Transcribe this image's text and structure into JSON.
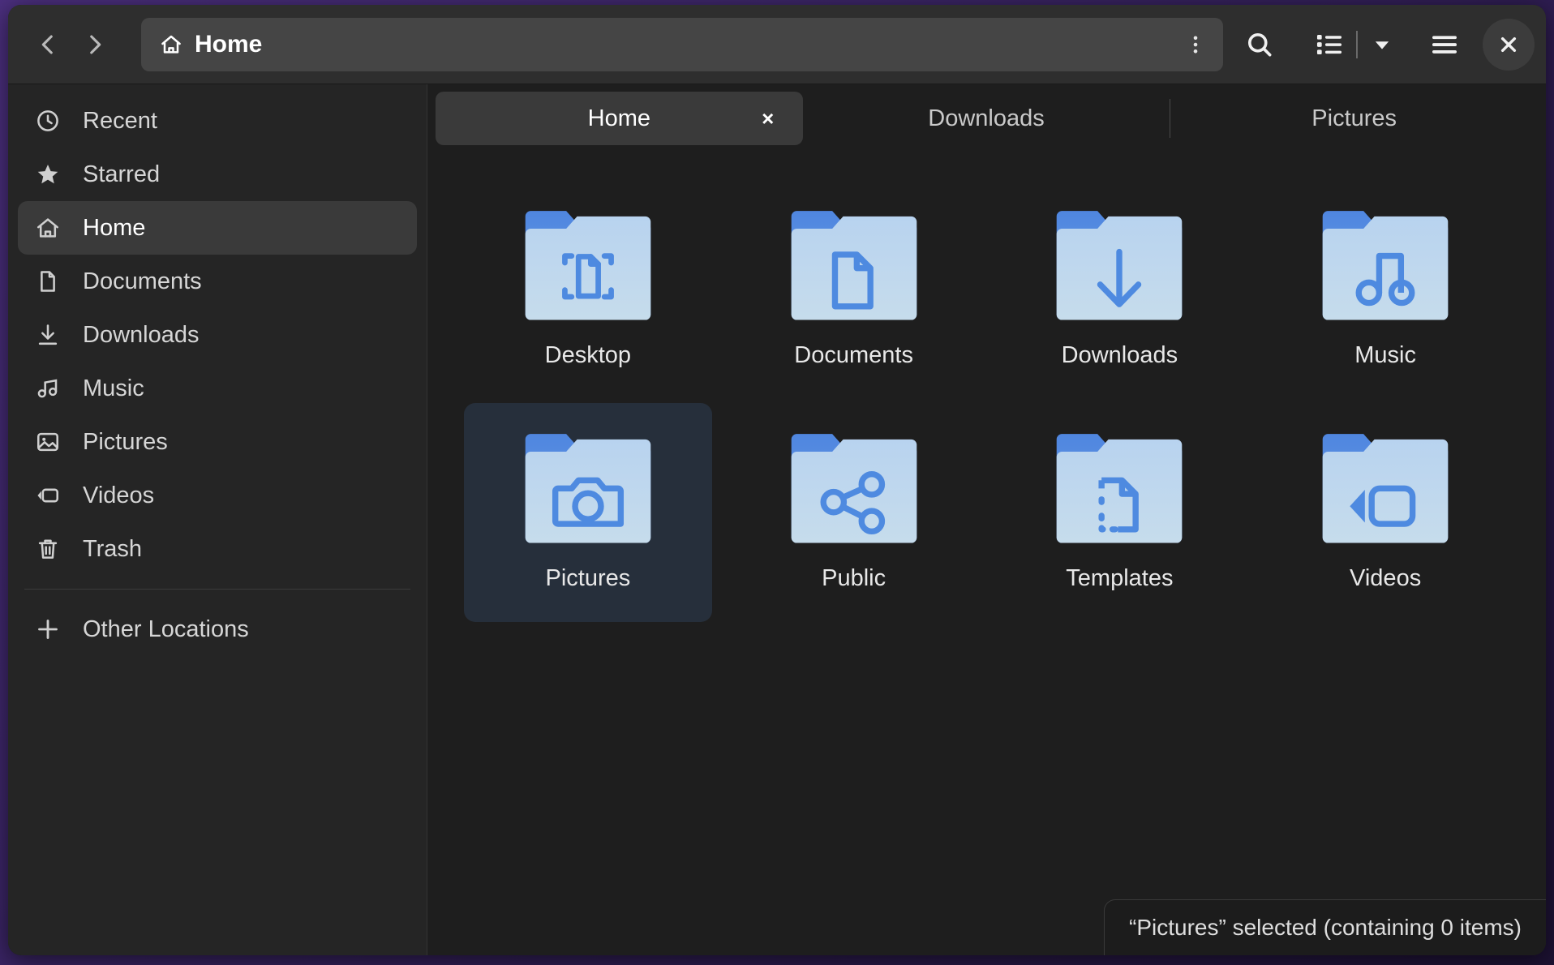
{
  "window": {
    "title": "Home",
    "accent_color": "#3584e4",
    "folder_icon_color": "#3584e4",
    "selection_color": "#262f3b",
    "headerbar_color": "#2e2e2e",
    "sidebar_color": "#252525",
    "content_color": "#1e1e1e"
  },
  "headerbar": {
    "back_label": "Back",
    "back_icon": "chevron-left-icon",
    "forward_label": "Forward",
    "forward_icon": "chevron-right-icon",
    "pathbar": {
      "icon": "home-icon",
      "crumb": "Home",
      "menu_icon": "vertical-ellipsis-icon",
      "menu_label": "Path Bar Menu"
    },
    "buttons": [
      {
        "name": "search-button",
        "icon": "search-icon",
        "label": "Search"
      },
      {
        "name": "view-list-button",
        "icon": "list-view-icon",
        "label": "List View"
      },
      {
        "name": "view-options-button",
        "icon": "chevron-down-icon",
        "label": "View Options"
      },
      {
        "name": "main-menu-button",
        "icon": "hamburger-icon",
        "label": "Main Menu"
      },
      {
        "name": "close-window-button",
        "icon": "close-icon",
        "label": "Close"
      }
    ]
  },
  "sidebar": {
    "items": [
      {
        "label": "Recent",
        "icon": "clock-icon",
        "selected": false
      },
      {
        "label": "Starred",
        "icon": "star-icon",
        "selected": false
      },
      {
        "label": "Home",
        "icon": "home-icon",
        "selected": true
      },
      {
        "label": "Documents",
        "icon": "document-icon",
        "selected": false
      },
      {
        "label": "Downloads",
        "icon": "download-icon",
        "selected": false
      },
      {
        "label": "Music",
        "icon": "music-note-icon",
        "selected": false
      },
      {
        "label": "Pictures",
        "icon": "image-icon",
        "selected": false
      },
      {
        "label": "Videos",
        "icon": "video-camera-icon",
        "selected": false
      },
      {
        "label": "Trash",
        "icon": "trash-icon",
        "selected": false
      }
    ],
    "footer": {
      "label": "Other Locations",
      "icon": "plus-icon"
    }
  },
  "tabs": [
    {
      "label": "Home",
      "active": true,
      "close_icon": "close-icon",
      "close_label": "×"
    },
    {
      "label": "Downloads",
      "active": false
    },
    {
      "label": "Pictures",
      "active": false
    }
  ],
  "files": [
    {
      "label": "Desktop",
      "icon": "folder-desktop-icon",
      "selected": false
    },
    {
      "label": "Documents",
      "icon": "folder-documents-icon",
      "selected": false
    },
    {
      "label": "Downloads",
      "icon": "folder-downloads-icon",
      "selected": false
    },
    {
      "label": "Music",
      "icon": "folder-music-icon",
      "selected": false
    },
    {
      "label": "Pictures",
      "icon": "folder-pictures-icon",
      "selected": true
    },
    {
      "label": "Public",
      "icon": "folder-public-icon",
      "selected": false
    },
    {
      "label": "Templates",
      "icon": "folder-templates-icon",
      "selected": false
    },
    {
      "label": "Videos",
      "icon": "folder-videos-icon",
      "selected": false
    }
  ],
  "statusbar": {
    "text": "“Pictures” selected (containing 0 items)"
  }
}
